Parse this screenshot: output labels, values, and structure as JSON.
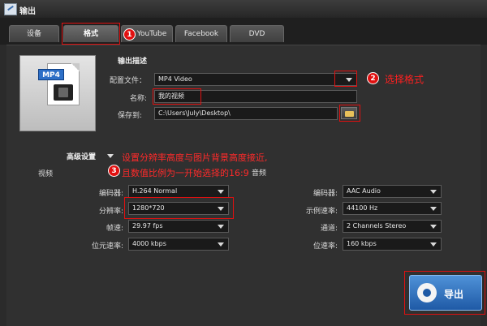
{
  "window": {
    "title": "输出"
  },
  "tabs": [
    {
      "label": "设备"
    },
    {
      "label": "格式"
    },
    {
      "label": "YouTube"
    },
    {
      "label": "Facebook"
    },
    {
      "label": "DVD"
    }
  ],
  "thumbnail": {
    "format_label": "MP4"
  },
  "output_desc": {
    "heading": "输出描述",
    "profile_label": "配置文件：",
    "profile_value": "MP4 Video",
    "name_label": "名称:",
    "name_value": "我的视频",
    "save_label": "保存到:",
    "save_value": "C:\\Users\\July\\Desktop\\"
  },
  "advanced": {
    "label": "高级设置"
  },
  "video": {
    "section_label": "视频",
    "encoder_label": "编码器:",
    "encoder_value": "H.264 Normal",
    "resolution_label": "分辨率:",
    "resolution_value": "1280*720",
    "framerate_label": "帧速:",
    "framerate_value": "29.97 fps",
    "bitrate_label": "位元速率:",
    "bitrate_value": "4000 kbps"
  },
  "audio": {
    "section_label": "音频",
    "encoder_label": "编码器:",
    "encoder_value": "AAC Audio",
    "samplerate_label": "示例速率:",
    "samplerate_value": "44100 Hz",
    "channels_label": "通道:",
    "channels_value": "2 Channels Stereo",
    "bitrate_label": "位速率:",
    "bitrate_value": "160 kbps"
  },
  "export": {
    "label": "导出"
  },
  "annotations": {
    "badge1": "1",
    "badge2": "2",
    "badge3": "3",
    "step2_text": "选择格式",
    "step3_line1": "设置分辨率高度与图片背景高度接近,",
    "step3_line2": "且数值比例为一开始选择的16:9"
  },
  "colors": {
    "annotation": "#e01010",
    "accent": "#2d6fc7"
  }
}
